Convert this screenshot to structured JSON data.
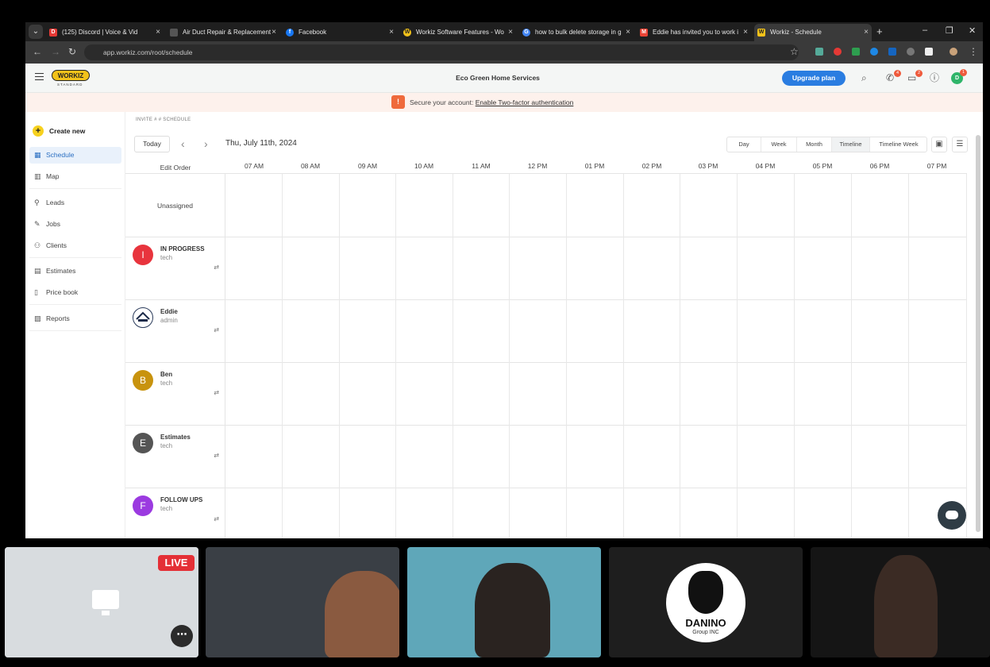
{
  "browser": {
    "tabs": [
      {
        "title": "(125) Discord | Voice & Vid",
        "fav": "red",
        "fav_text": "D"
      },
      {
        "title": "Air Duct Repair & Replacement",
        "fav": "#555",
        "fav_text": "▪"
      },
      {
        "title": "Facebook",
        "fav": "#1877f2",
        "fav_text": "f"
      },
      {
        "title": "Workiz Software Features - Wo",
        "fav": "#f2c21a",
        "fav_text": "W"
      },
      {
        "title": "how to bulk delete storage in g",
        "fav": "#4285f4",
        "fav_text": "G"
      },
      {
        "title": "Eddie has invited you to work i",
        "fav": "#ea4335",
        "fav_text": "M"
      },
      {
        "title": "Workiz - Schedule",
        "fav": "#f2c21a",
        "fav_text": "W"
      }
    ],
    "url": "app.workiz.com/root/schedule"
  },
  "app": {
    "logo": "WORKIZ",
    "logo_sub": "STANDARD",
    "company": "Eco Green Home Services",
    "upgrade_label": "Upgrade plan",
    "phone_badge": "4",
    "chat_badge": "2",
    "user_badge": "1",
    "user_initial": "D",
    "secure_msg": "Secure your account:",
    "secure_link": "Enable Two-factor authentication"
  },
  "sidebar": {
    "create_label": "Create new",
    "items": [
      {
        "label": "Schedule",
        "icon": "calendar-icon"
      },
      {
        "label": "Map",
        "icon": "map-icon"
      },
      {
        "label": "Leads",
        "icon": "leads-icon"
      },
      {
        "label": "Jobs",
        "icon": "wrench-icon"
      },
      {
        "label": "Clients",
        "icon": "people-icon"
      },
      {
        "label": "Estimates",
        "icon": "estimate-icon"
      },
      {
        "label": "Price book",
        "icon": "book-icon"
      },
      {
        "label": "Reports",
        "icon": "chart-icon"
      }
    ]
  },
  "schedule": {
    "breadcrumb": "INVITE # # SCHEDULE",
    "today_label": "Today",
    "date": "Thu, July 11th, 2024",
    "views": [
      "Day",
      "Week",
      "Month",
      "Timeline",
      "Timeline Week"
    ],
    "active_view": "Timeline",
    "edit_order": "Edit Order",
    "hours": [
      "07 AM",
      "08 AM",
      "09 AM",
      "10 AM",
      "11 AM",
      "12 PM",
      "01 PM",
      "02 PM",
      "03 PM",
      "04 PM",
      "05 PM",
      "06 PM",
      "07 PM"
    ],
    "unassigned": "Unassigned",
    "rows": [
      {
        "name": "IN PROGRESS",
        "role": "tech",
        "initial": "I",
        "color": "#e8343d"
      },
      {
        "name": "Eddie",
        "role": "admin",
        "initial": "",
        "color": "#ffffff"
      },
      {
        "name": "Ben",
        "role": "tech",
        "initial": "B",
        "color": "#c8930e"
      },
      {
        "name": "Estimates",
        "role": "tech",
        "initial": "E",
        "color": "#555555"
      },
      {
        "name": "FOLLOW UPS",
        "role": "tech",
        "initial": "F",
        "color": "#9b3ae0"
      }
    ]
  },
  "meeting": {
    "live_label": "LIVE",
    "danino_name": "DANINO",
    "danino_sub": "Group INC"
  }
}
